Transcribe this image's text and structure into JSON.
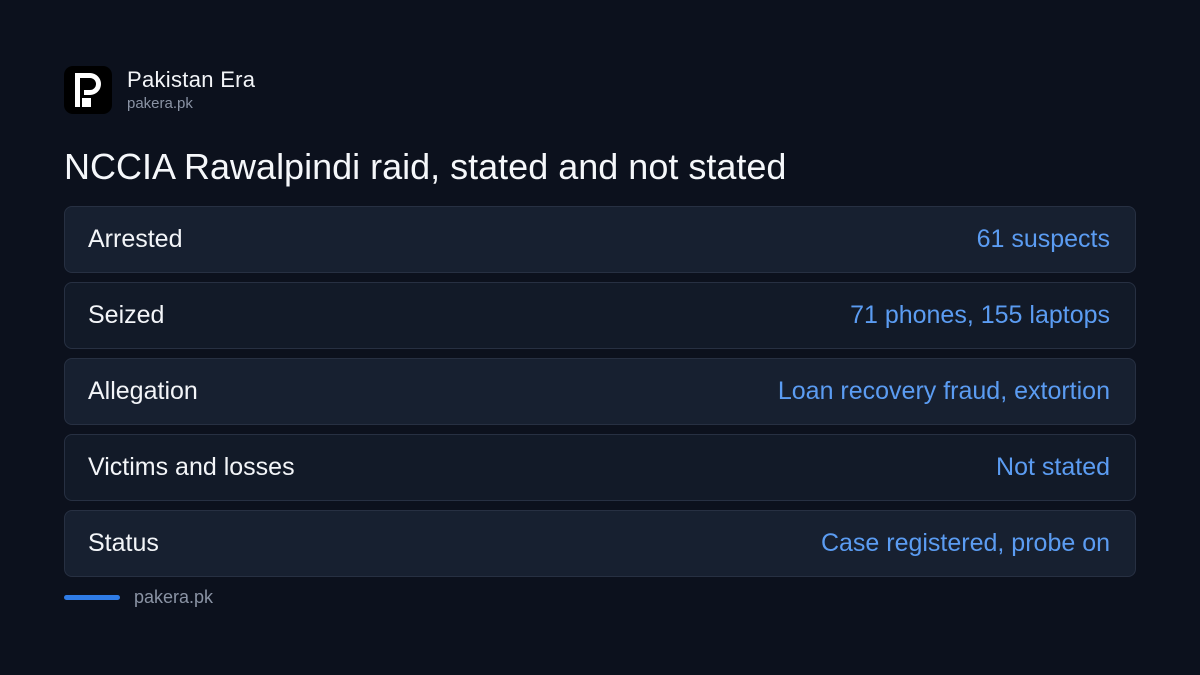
{
  "brand": {
    "name": "Pakistan Era",
    "url": "pakera.pk",
    "logo_icon": "pakistan-era-logo-icon"
  },
  "title": "NCCIA Rawalpindi raid, stated and not stated",
  "rows": [
    {
      "label": "Arrested",
      "value": "61 suspects"
    },
    {
      "label": "Seized",
      "value": "71 phones, 155 laptops"
    },
    {
      "label": "Allegation",
      "value": "Loan recovery fraud, extortion"
    },
    {
      "label": "Victims and losses",
      "value": "Not stated"
    },
    {
      "label": "Status",
      "value": "Case registered, probe on"
    }
  ],
  "footer": {
    "url": "pakera.pk"
  },
  "colors": {
    "background": "#0c111d",
    "accent": "#2f7ce6",
    "value_text": "#5b9cf2",
    "row_border": "#273042"
  }
}
